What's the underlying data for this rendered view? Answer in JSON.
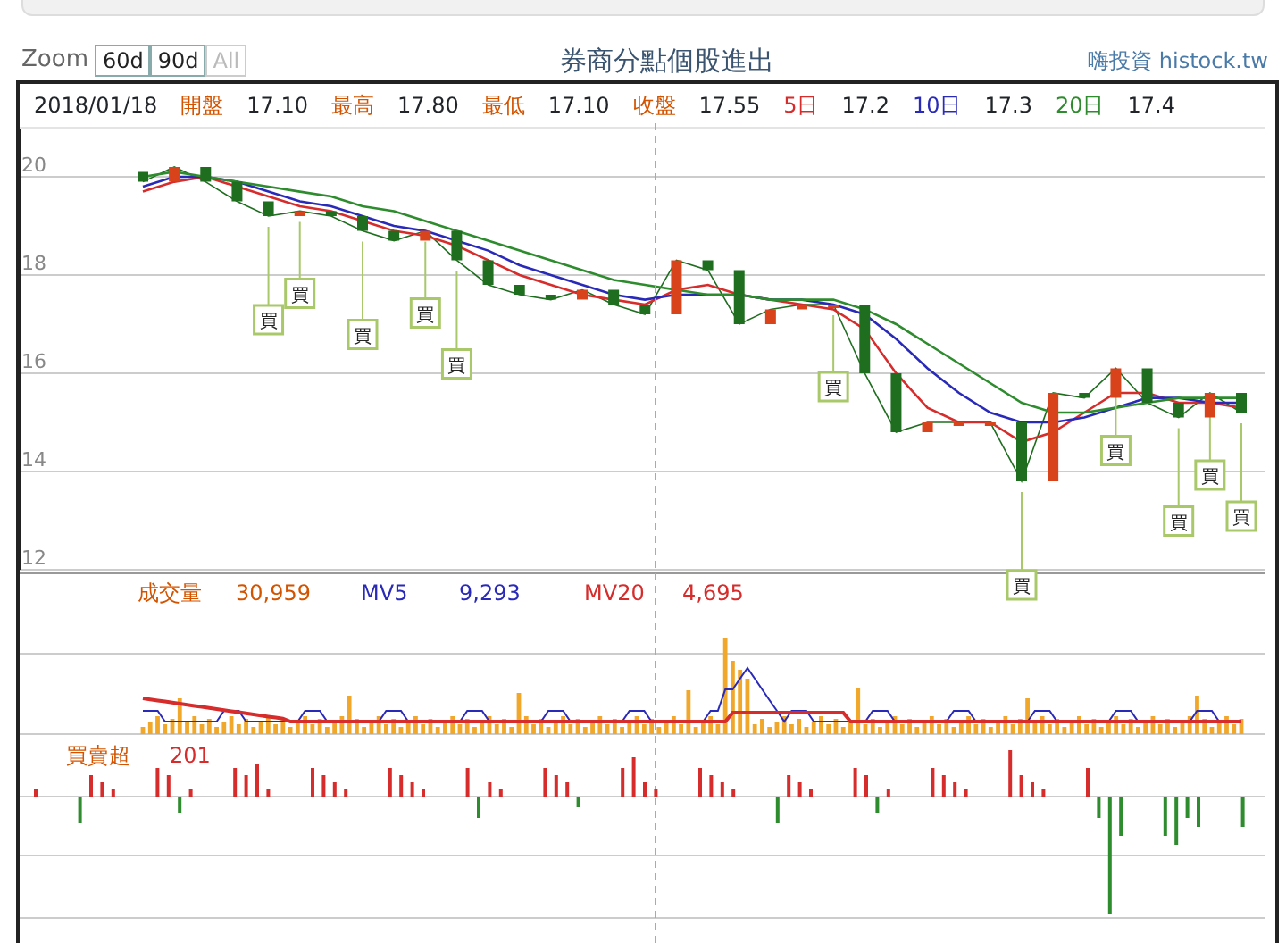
{
  "toolbar": {
    "zoom_label": "Zoom",
    "zoom_buttons": [
      {
        "label": "60d",
        "disabled": false
      },
      {
        "label": "90d",
        "disabled": false
      },
      {
        "label": "All",
        "disabled": true
      }
    ],
    "title": "券商分點個股進出",
    "source": "嗨投資 histock.tw"
  },
  "info": {
    "date": "2018/01/18",
    "fields": [
      {
        "label": "開盤",
        "value": "17.10",
        "color": "#d35400"
      },
      {
        "label": "最高",
        "value": "17.80",
        "color": "#d35400"
      },
      {
        "label": "最低",
        "value": "17.10",
        "color": "#d35400"
      },
      {
        "label": "收盤",
        "value": "17.55",
        "color": "#d35400"
      },
      {
        "label": "5日",
        "value": "17.2",
        "color": "#d62c2c"
      },
      {
        "label": "10日",
        "value": "17.3",
        "color": "#2a2ab8"
      },
      {
        "label": "20日",
        "value": "17.4",
        "color": "#2e8b2e"
      }
    ]
  },
  "price_chart": {
    "days": [
      {
        "marked": false
      },
      {
        "marked": false
      },
      {
        "marked": false
      },
      {
        "marked": false
      },
      {
        "marked": true,
        "marker": "買"
      },
      {
        "marked": true,
        "marker": "買"
      },
      {
        "marked": false
      },
      {
        "marked": true,
        "marker": "買"
      },
      {
        "marked": false
      },
      {
        "marked": true,
        "marker": "買"
      },
      {
        "marked": true,
        "marker": "買"
      },
      {
        "marked": false
      },
      {
        "marked": false
      },
      {
        "marked": false
      },
      {
        "marked": false
      },
      {
        "marked": false
      },
      {
        "marked": false
      },
      {
        "marked": false
      },
      {
        "marked": false
      },
      {
        "marked": false
      },
      {
        "marked": false
      },
      {
        "marked": false
      },
      {
        "marked": true,
        "marker": "買"
      },
      {
        "marked": false
      },
      {
        "marked": false
      },
      {
        "marked": false
      },
      {
        "marked": false
      },
      {
        "marked": false
      },
      {
        "marked": true,
        "marker": "買"
      },
      {
        "marked": false
      },
      {
        "marked": false
      },
      {
        "marked": true,
        "marker": "買"
      },
      {
        "marked": false
      },
      {
        "marked": true,
        "marker": "買"
      },
      {
        "marked": true,
        "marker": "買"
      },
      {
        "marked": true,
        "marker": "買"
      }
    ],
    "chart_data": {
      "type": "line",
      "grid": true,
      "ylim": [
        12,
        21
      ],
      "yticks": [
        12,
        14,
        16,
        18,
        20
      ],
      "series": [
        {
          "color": "#1f6e1f",
          "values": [
            19.9,
            20.2,
            19.9,
            19.5,
            19.2,
            19.3,
            19.2,
            18.9,
            18.7,
            18.9,
            18.3,
            17.8,
            17.6,
            17.5,
            17.7,
            17.4,
            17.2,
            18.3,
            18.1,
            17.0,
            17.3,
            17.4,
            17.4,
            16.0,
            14.8,
            15.0,
            15.0,
            15.0,
            13.8,
            15.6,
            15.5,
            16.1,
            15.4,
            15.1,
            15.6,
            15.2
          ]
        },
        {
          "color": "#d62c2c",
          "values": [
            19.7,
            19.9,
            20.0,
            19.8,
            19.6,
            19.4,
            19.3,
            19.1,
            18.9,
            18.8,
            18.6,
            18.3,
            18.0,
            17.8,
            17.6,
            17.5,
            17.4,
            17.7,
            17.8,
            17.6,
            17.5,
            17.4,
            17.3,
            16.9,
            16.0,
            15.3,
            15.0,
            15.0,
            14.6,
            14.8,
            15.2,
            15.6,
            15.6,
            15.4,
            15.4,
            15.3
          ]
        },
        {
          "color": "#2a2ab8",
          "values": [
            19.8,
            20.0,
            20.0,
            19.9,
            19.7,
            19.5,
            19.4,
            19.2,
            19.0,
            18.9,
            18.7,
            18.5,
            18.2,
            18.0,
            17.8,
            17.6,
            17.5,
            17.6,
            17.6,
            17.6,
            17.5,
            17.5,
            17.4,
            17.2,
            16.7,
            16.1,
            15.6,
            15.2,
            15.0,
            15.0,
            15.1,
            15.3,
            15.5,
            15.5,
            15.4,
            15.4
          ]
        },
        {
          "color": "#2e8b2e",
          "values": [
            20.0,
            20.1,
            20.0,
            19.9,
            19.8,
            19.7,
            19.6,
            19.4,
            19.3,
            19.1,
            18.9,
            18.7,
            18.5,
            18.3,
            18.1,
            17.9,
            17.8,
            17.7,
            17.6,
            17.6,
            17.5,
            17.5,
            17.5,
            17.3,
            17.0,
            16.6,
            16.2,
            15.8,
            15.4,
            15.2,
            15.2,
            15.3,
            15.4,
            15.5,
            15.5,
            15.5
          ]
        }
      ]
    }
  },
  "volume_panel": {
    "legend": [
      {
        "label": "成交量",
        "value": "30,959",
        "color": "#d35400"
      },
      {
        "label": "MV5",
        "value": "9,293",
        "color": "#2a2ab8"
      },
      {
        "label": "MV20",
        "value": "4,695",
        "color": "#d62c2c"
      }
    ]
  },
  "net_panel": {
    "label": "買賣超",
    "value": "201"
  }
}
